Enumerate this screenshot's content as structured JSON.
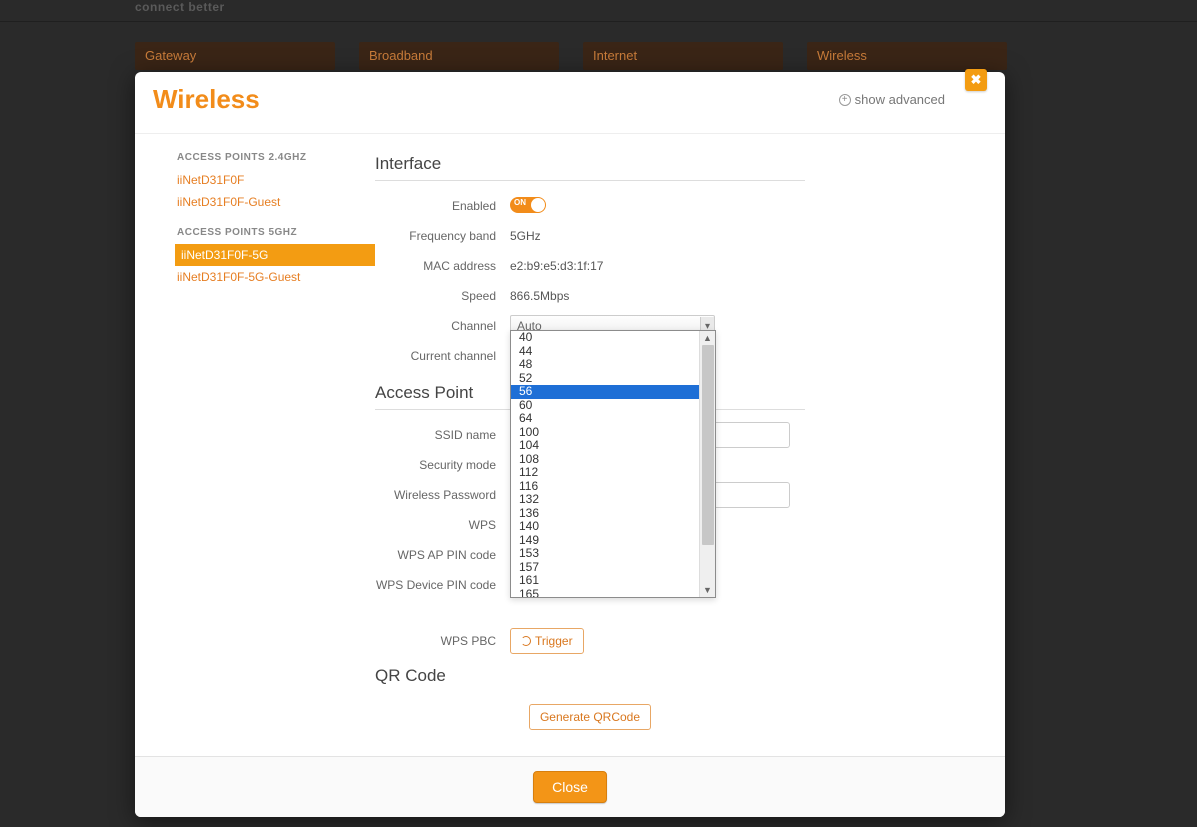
{
  "brand_tagline": "connect better",
  "tabs": [
    "Gateway",
    "Broadband",
    "Internet",
    "Wireless"
  ],
  "modal": {
    "title": "Wireless",
    "show_advanced": "show advanced",
    "close_label": "Close"
  },
  "sidebar": {
    "group24_title": "ACCESS POINTS 2.4GHZ",
    "group24_items": [
      "iiNetD31F0F",
      "iiNetD31F0F-Guest"
    ],
    "group5_title": "ACCESS POINTS 5GHZ",
    "group5_items": [
      "iiNetD31F0F-5G",
      "iiNetD31F0F-5G-Guest"
    ],
    "active_item": "iiNetD31F0F-5G"
  },
  "interface": {
    "section_title": "Interface",
    "labels": {
      "enabled": "Enabled",
      "frequency": "Frequency band",
      "mac": "MAC address",
      "speed": "Speed",
      "channel": "Channel",
      "current_channel": "Current channel"
    },
    "enabled_state": "ON",
    "frequency": "5GHz",
    "mac": "e2:b9:e5:d3:1f:17",
    "speed": "866.5Mbps",
    "channel_selected": "Auto",
    "channel_options": [
      "40",
      "44",
      "48",
      "52",
      "56",
      "60",
      "64",
      "100",
      "104",
      "108",
      "112",
      "116",
      "132",
      "136",
      "140",
      "149",
      "153",
      "157",
      "161",
      "165"
    ],
    "channel_highlight": "56"
  },
  "access_point": {
    "section_title": "Access Point",
    "labels": {
      "ssid": "SSID name",
      "security": "Security mode",
      "password": "Wireless Password",
      "wps": "WPS",
      "wps_ap_pin": "WPS AP PIN code",
      "wps_device_pin": "WPS Device PIN code",
      "wps_pbc": "WPS PBC"
    },
    "trigger_label": "Trigger"
  },
  "qr": {
    "section_title": "QR Code",
    "generate_label": "Generate QRCode"
  }
}
